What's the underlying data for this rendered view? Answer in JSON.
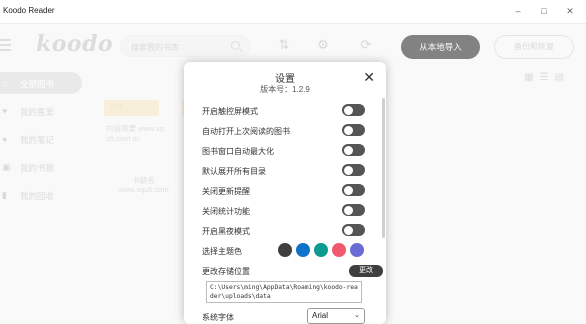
{
  "window": {
    "title": "Koodo Reader",
    "minimize": "–",
    "maximize": "□",
    "close": "✕"
  },
  "header": {
    "logo": "koodo",
    "search_placeholder": "搜索我的书库",
    "import_label": "从本地导入",
    "backup_label": "备份和恢复"
  },
  "sidebar": {
    "items": [
      {
        "label": "全部图书",
        "icon": "home-icon",
        "active": true
      },
      {
        "label": "我的喜爱",
        "icon": "heart-icon",
        "active": false
      },
      {
        "label": "我的笔记",
        "icon": "bulb-icon",
        "active": false
      },
      {
        "label": "我的书摘",
        "icon": "bookmark-icon",
        "active": false
      },
      {
        "label": "我的回收",
        "icon": "trash-icon",
        "active": false
      }
    ]
  },
  "books": [
    {
      "cover": "TXT",
      "snippet": "内容简要 www.xqu5.com m",
      "name": "书籍名 www.xqu5.com"
    }
  ],
  "settings": {
    "title": "设置",
    "version": "版本号：1.2.9",
    "toggles": [
      {
        "label": "开启触控屏模式",
        "on": false
      },
      {
        "label": "自动打开上次阅读的图书",
        "on": false
      },
      {
        "label": "图书窗口自动最大化",
        "on": false
      },
      {
        "label": "默认展开所有目录",
        "on": false
      },
      {
        "label": "关闭更新提醒",
        "on": false
      },
      {
        "label": "关闭统计功能",
        "on": false
      },
      {
        "label": "开启黑夜模式",
        "on": false
      }
    ],
    "theme_label": "选择主题色",
    "theme_colors": [
      "#3f3f3f",
      "#0e72c8",
      "#0e9a8f",
      "#ef5b6c",
      "#6c6bd6"
    ],
    "storage_label": "更改存储位置",
    "storage_button": "更改",
    "storage_path": "C:\\Users\\ming\\AppData\\Roaming\\koodo-reader\\uploads\\data",
    "font_label": "系统字体",
    "font_value": "Arial"
  }
}
